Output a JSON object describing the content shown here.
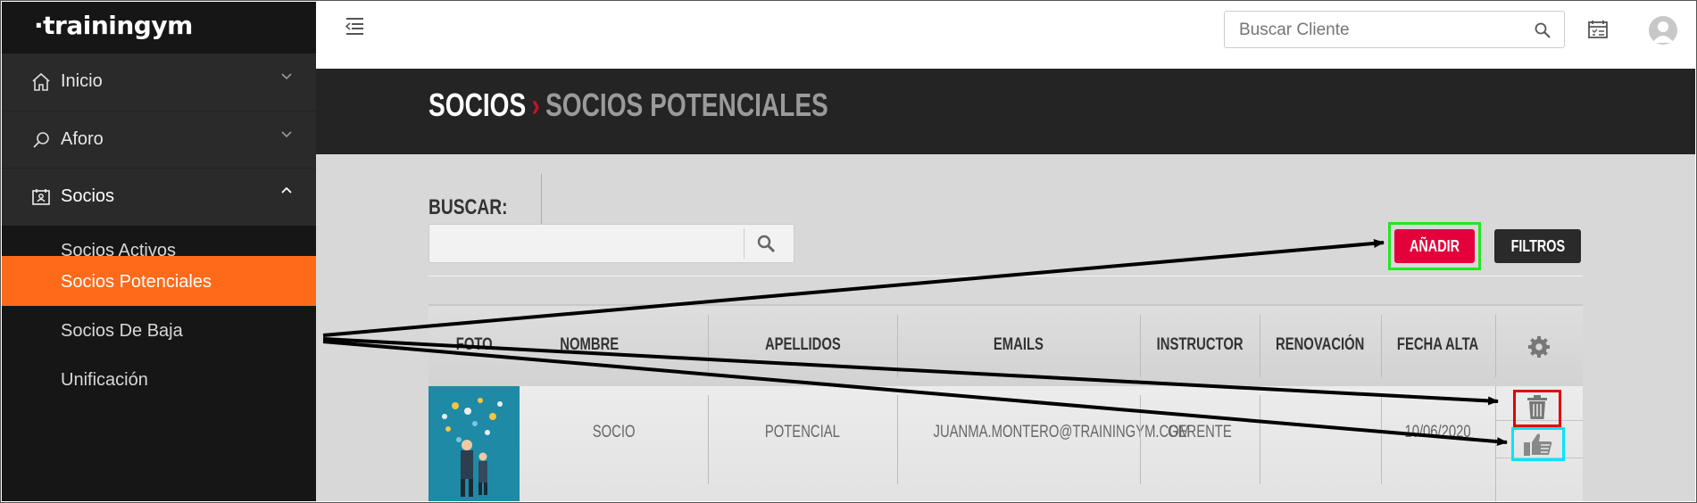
{
  "app": {
    "logo_text": "·trainingym"
  },
  "sidebar": {
    "items": [
      {
        "label": "Inicio",
        "icon": "home-icon"
      },
      {
        "label": "Aforo",
        "icon": "search-icon"
      },
      {
        "label": "Socios",
        "icon": "members-card-icon"
      }
    ],
    "subitems": [
      {
        "label": "Socios Activos"
      },
      {
        "label": "Socios Potenciales",
        "active": true
      },
      {
        "label": "Socios De Baja"
      },
      {
        "label": "Unificación"
      }
    ],
    "active_color": "#ff6a1a"
  },
  "header": {
    "search_placeholder": "Buscar Cliente"
  },
  "breadcrumb": {
    "parent": "SOCIOS",
    "separator": "›",
    "current": "SOCIOS POTENCIALES"
  },
  "filters": {
    "search_label": "BUSCAR:",
    "search_value": "",
    "add_label": "AÑADIR",
    "filters_label": "FILTROS"
  },
  "table": {
    "columns": [
      "FOTO",
      "NOMBRE",
      "APELLIDOS",
      "EMAILS",
      "INSTRUCTOR",
      "RENOVACIÓN",
      "FECHA ALTA"
    ],
    "rows": [
      {
        "nombre": "SOCIO",
        "apellidos": "POTENCIAL",
        "email": "JUANMA.MONTERO@TRAININGYM.COM",
        "instructor": "GERENTE",
        "renovacion": "",
        "fecha_alta": "10/06/2020"
      }
    ]
  },
  "colors": {
    "accent_red": "#e4003a",
    "highlight_green": "#22e622",
    "highlight_red": "#e00000",
    "highlight_cyan": "#00e5ff"
  }
}
